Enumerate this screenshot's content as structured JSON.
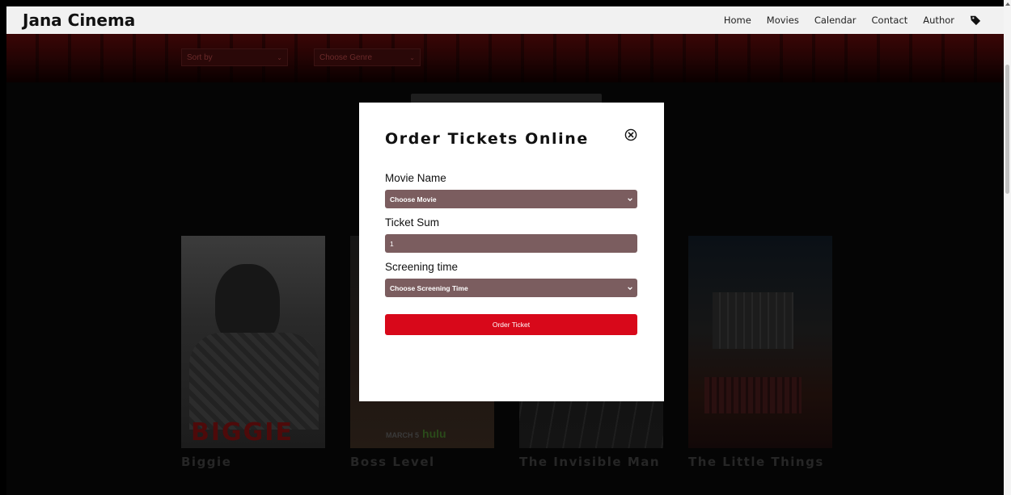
{
  "navbar": {
    "brand": "Jana Cinema",
    "links": [
      "Home",
      "Movies",
      "Calendar",
      "Contact",
      "Author"
    ],
    "tag_icon": "tag-icon"
  },
  "filters": {
    "sort_placeholder": "Sort by",
    "genre_placeholder": "Choose Genre"
  },
  "movies": [
    {
      "title": "Biggie",
      "poster_text": "BIGGIE"
    },
    {
      "title": "Boss Level",
      "poster_text": "MARCH 5",
      "poster_brand": "hulu"
    },
    {
      "title": "The Invisible Man"
    },
    {
      "title": "The Little Things"
    }
  ],
  "modal": {
    "title": "Order Tickets Online",
    "close_icon": "close-circle-icon",
    "movie_label": "Movie Name",
    "movie_select": "Choose Movie",
    "ticket_label": "Ticket Sum",
    "ticket_value": "1",
    "time_label": "Screening time",
    "time_select": "Choose Screening Time",
    "submit": "Order Ticket"
  },
  "colors": {
    "accent_red": "#d8081a",
    "field_bg": "#7b5d5f",
    "navbar_bg": "#f1f1f1",
    "page_bg": "#050505"
  }
}
